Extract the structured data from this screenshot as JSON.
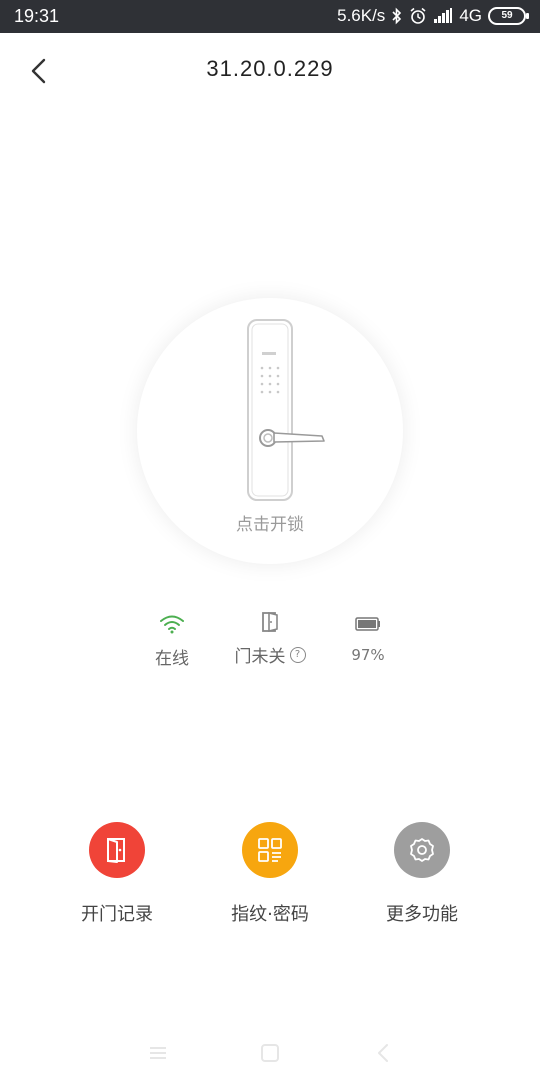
{
  "status_bar": {
    "time": "19:31",
    "speed": "5.6K/s",
    "network": "4G",
    "battery": "59"
  },
  "header": {
    "title": "31.20.0.229"
  },
  "lock": {
    "unlock_label": "点击开锁"
  },
  "status": {
    "online_label": "在线",
    "door_label": "门未关",
    "battery_label": "97%"
  },
  "actions": [
    {
      "label": "开门记录",
      "color": "#f04438"
    },
    {
      "label": "指纹·密码",
      "color": "#f7a60f"
    },
    {
      "label": "更多功能",
      "color": "#9e9e9e"
    }
  ],
  "colors": {
    "online_green": "#4caf50"
  }
}
